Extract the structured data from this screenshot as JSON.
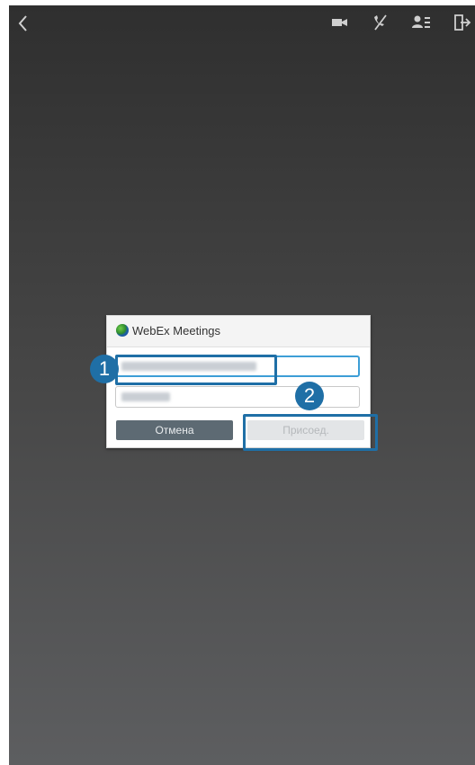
{
  "topbar": {
    "icons": [
      "back-icon",
      "video-icon",
      "mute-icon",
      "participants-icon",
      "exit-icon"
    ]
  },
  "dialog": {
    "title": "WebEx Meetings",
    "url_field": {
      "value": "",
      "state": "blurred"
    },
    "name_field": {
      "value": "",
      "state": "blurred"
    },
    "cancel_label": "Отмена",
    "join_label": "Присоед."
  },
  "callouts": [
    {
      "number": "1"
    },
    {
      "number": "2"
    }
  ],
  "colors": {
    "accent": "#1f6fa6",
    "focus": "#3d9ed6",
    "cancel_button": "#5d6a73",
    "join_button_disabled": "#e3e5e7"
  }
}
